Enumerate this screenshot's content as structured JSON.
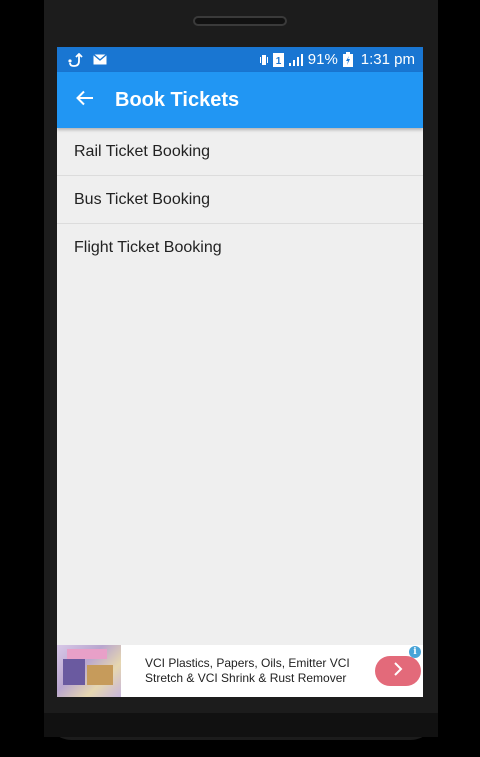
{
  "status_bar": {
    "battery": "91%",
    "time": "1:31 pm",
    "sim": "1",
    "left_icons": [
      "usb-debug-icon",
      "mail-icon"
    ],
    "right_icons": [
      "vibrate-icon",
      "sim-icon",
      "signal-icon",
      "battery-charging-icon"
    ]
  },
  "app_bar": {
    "title": "Book Tickets",
    "back_icon": "arrow-left-icon"
  },
  "list": {
    "items": [
      {
        "label": "Rail Ticket Booking"
      },
      {
        "label": "Bus Ticket Booking"
      },
      {
        "label": "Flight Ticket Booking"
      }
    ]
  },
  "ad": {
    "line1": "VCI Plastics, Papers, Oils, Emitter VCI",
    "line2": "Stretch & VCI Shrink & Rust Remover",
    "info_icon": "i"
  },
  "colors": {
    "status_bar": "#1976d2",
    "app_bar": "#2196f3",
    "background": "#efefef",
    "ad_button": "#e36a7a"
  }
}
